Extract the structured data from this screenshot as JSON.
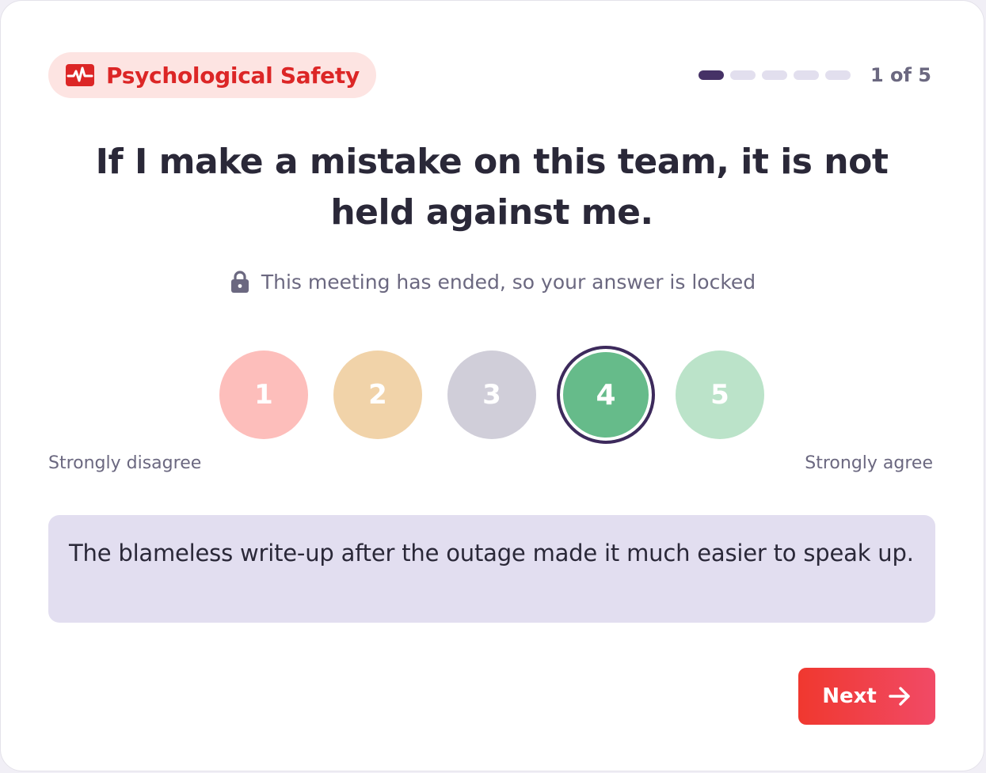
{
  "category": {
    "label": "Psychological Safety",
    "icon": "heartbeat-icon",
    "color": "#dc2626",
    "background": "#fde4e2"
  },
  "progress": {
    "current": 1,
    "total": 5,
    "text": "1 of 5"
  },
  "question": "If I make a mistake on this team, it is not held against me.",
  "locked_notice": {
    "icon": "lock-icon",
    "text": "This meeting has ended, so your answer is locked"
  },
  "scale": {
    "options": [
      {
        "value": "1",
        "color": "#fdbebb"
      },
      {
        "value": "2",
        "color": "#f1d3a9"
      },
      {
        "value": "3",
        "color": "#d0ced9"
      },
      {
        "value": "4",
        "color": "#66bb8a"
      },
      {
        "value": "5",
        "color": "#bbe3c9"
      }
    ],
    "selected": "4",
    "min_label": "Strongly disagree",
    "max_label": "Strongly agree"
  },
  "comment": "The blameless write-up after the outage made it much easier to speak up.",
  "next_button": {
    "label": "Next",
    "icon": "arrow-right-icon"
  }
}
